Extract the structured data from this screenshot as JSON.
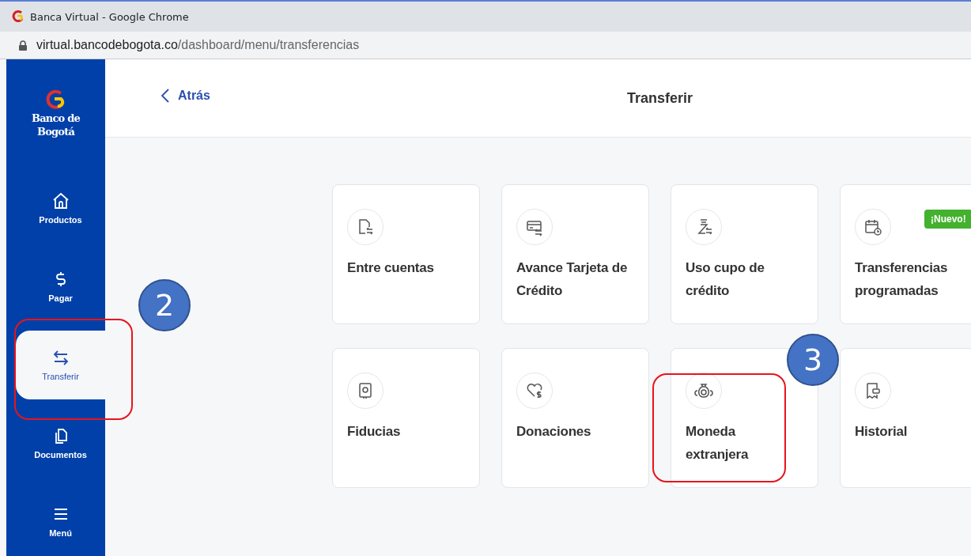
{
  "browser": {
    "title": "Banca Virtual - Google Chrome",
    "url_host": "virtual.bancodebogota.co",
    "url_path": "/dashboard/menu/transferencias"
  },
  "logo": {
    "line_1": "Banco de",
    "line_2": "Bogotá"
  },
  "sidebar": {
    "items": [
      {
        "kind": "home",
        "label": "Productos",
        "selected": false
      },
      {
        "kind": "dollar",
        "label": "Pagar",
        "selected": false
      },
      {
        "kind": "transfer",
        "label": "Transferir",
        "selected": true
      },
      {
        "kind": "documents",
        "label": "Documentos",
        "selected": false
      },
      {
        "kind": "menu",
        "label": "Menú",
        "selected": false
      }
    ]
  },
  "header": {
    "back": "Atrás",
    "title": "Transferir"
  },
  "cards": [
    {
      "kind": "doc-transfer",
      "label": "Entre cuentas"
    },
    {
      "kind": "card-transfer",
      "label": "Avance Tarjeta de Crédito"
    },
    {
      "kind": "bag-transfer",
      "label": "Uso cupo de crédito"
    },
    {
      "kind": "calendar",
      "label": "Transferencias programadas",
      "badge": "¡Nuevo!"
    },
    {
      "kind": "safe",
      "label": "Fiducias"
    },
    {
      "kind": "heart",
      "label": "Donaciones"
    },
    {
      "kind": "moneybag",
      "label": "Moneda extranjera"
    },
    {
      "kind": "receipt",
      "label": "Historial"
    }
  ],
  "annotations": [
    {
      "number": "2"
    },
    {
      "number": "3"
    }
  ]
}
